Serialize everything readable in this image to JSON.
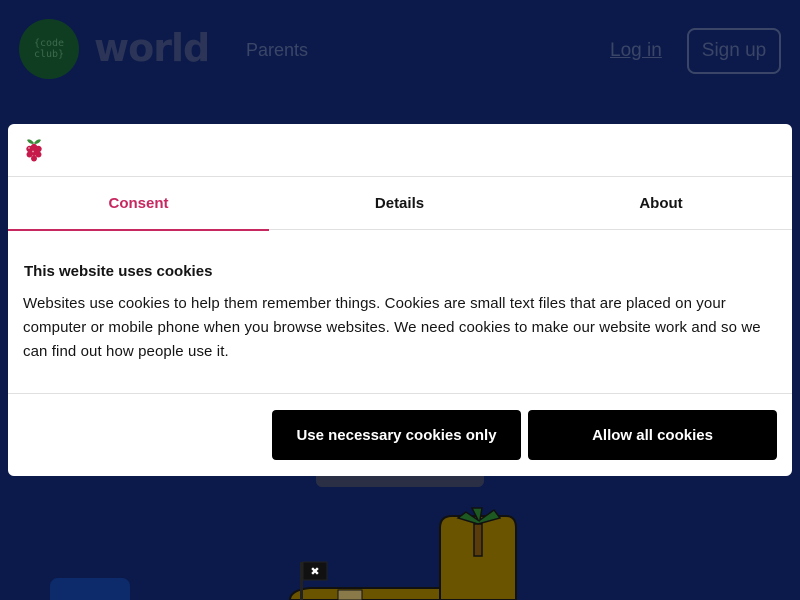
{
  "header": {
    "logo_lines": [
      "{code",
      "club}"
    ],
    "brand": "world",
    "nav_parents": "Parents",
    "login": "Log in",
    "signup": "Sign up"
  },
  "cookie_dialog": {
    "tabs": [
      {
        "label": "Consent",
        "active": true
      },
      {
        "label": "Details",
        "active": false
      },
      {
        "label": "About",
        "active": false
      }
    ],
    "title": "This website uses cookies",
    "body": "Websites use cookies to help them remember things. Cookies are small text files that are placed on your computer or mobile phone when you browse websites. We need cookies to make our website work and so we can find out how people use it.",
    "btn_necessary": "Use necessary cookies only",
    "btn_allow": "Allow all cookies",
    "accent_color": "#c6285f"
  },
  "icons": {
    "logo": "raspberry-pi-icon"
  }
}
